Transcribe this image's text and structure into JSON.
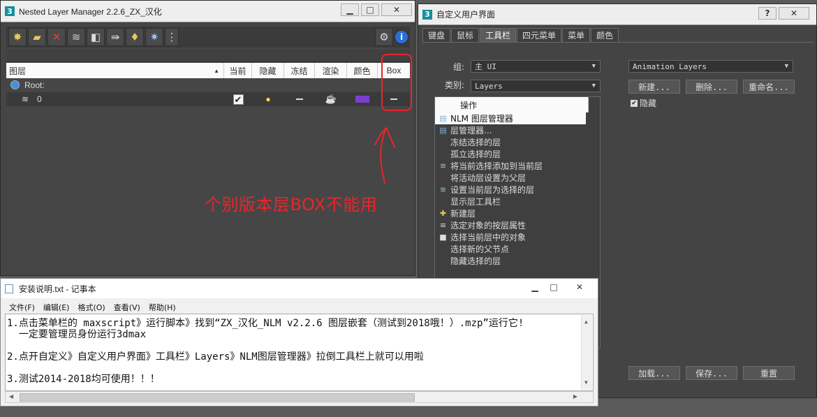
{
  "nlm": {
    "title": "Nested Layer Manager 2.2.6_ZX_汉化",
    "app_icon": "3",
    "win_min": "▁",
    "win_max": "□",
    "win_close": "✕",
    "toolbar_icons": [
      "new-layer-icon",
      "new-layer-folder-icon",
      "delete-icon",
      "add-to-layer-icon",
      "objects-icon",
      "select-icon",
      "light-icon",
      "settings-star-icon",
      "more-icon"
    ],
    "header": {
      "layer": "图层",
      "current": "当前",
      "hide": "隐藏",
      "freeze": "冻结",
      "render": "渲染",
      "color": "颜色",
      "box": "Box",
      "sort_glyph": "▲"
    },
    "rows": [
      {
        "name": "Root:"
      },
      {
        "name": "0",
        "color": "#7b3fd0"
      }
    ],
    "annotation": "个别版本层BOX不能用"
  },
  "cui": {
    "title": "自定义用户界面",
    "app_icon": "3",
    "help": "?",
    "close": "✕",
    "tabs": [
      "键盘",
      "鼠标",
      "工具栏",
      "四元菜单",
      "菜单",
      "颜色"
    ],
    "active_tab": "工具栏",
    "group_label": "组:",
    "group_value": "主 UI",
    "category_label": "类别:",
    "category_value": "Layers",
    "toolbar_select": "Animation Layers",
    "new_btn": "新建...",
    "delete_btn": "删除...",
    "rename_btn": "重命名...",
    "hide_check": "✔",
    "hide_label": "隐藏",
    "action_header": "操作",
    "actions": [
      "NLM 图层管理器",
      "层管理器...",
      "冻结选择的层",
      "孤立选择的层",
      "将当前选择添加到当前层",
      "将活动层设置为父层",
      "设置当前层为选择的层",
      "显示层工具栏",
      "新建层",
      "选定对象的按层属性",
      "选择当前层中的对象",
      "选择新的父节点",
      "隐藏选择的层"
    ],
    "load_btn": "加载...",
    "save_btn": "保存...",
    "reset_btn": "重置"
  },
  "notepad": {
    "title": "安装说明.txt - 记事本",
    "win_min": "▁",
    "win_max": "□",
    "win_close": "✕",
    "menu": [
      "文件(F)",
      "编辑(E)",
      "格式(O)",
      "查看(V)",
      "帮助(H)"
    ],
    "line1": "1.点击菜单栏的 maxscript》运行脚本》找到“ZX_汉化_NLM v2.2.6 图层嵌套（测试到2018哦！）.mzp”运行它!",
    "line1b": "  一定要管理员身份运行3dmax",
    "line2": "2.点开自定义》自定义用户界面》工具栏》Layers》NLM图层管理器》拉倒工具栏上就可以用啦",
    "line3": "3.测试2014-2018均可使用！！！"
  }
}
